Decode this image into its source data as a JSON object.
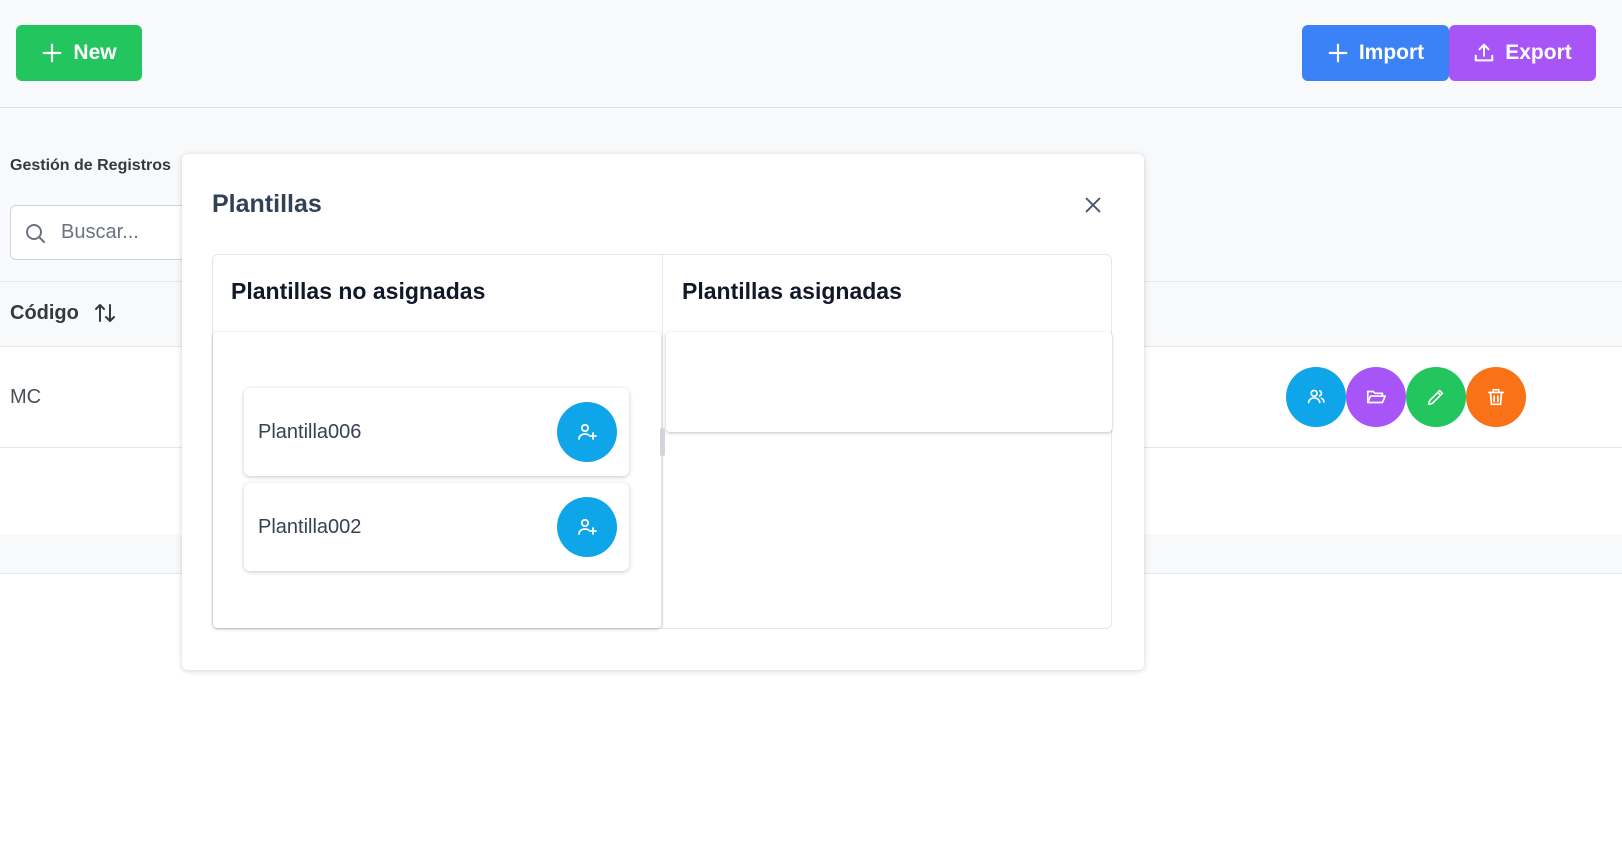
{
  "toolbar": {
    "new_label": "New",
    "import_label": "Import",
    "export_label": "Export"
  },
  "table": {
    "section_title": "Gestión de Registros",
    "search_placeholder": "Buscar...",
    "column_codigo": "Código",
    "rows": [
      {
        "codigo": "MC"
      }
    ],
    "row_actions": [
      "users-icon",
      "folder-open-icon",
      "pencil-icon",
      "trash-icon"
    ]
  },
  "modal": {
    "title": "Plantillas",
    "source_header": "Plantillas no asignadas",
    "target_header": "Plantillas asignadas",
    "source_items": [
      "Plantilla006",
      "Plantilla002"
    ],
    "target_items": []
  },
  "colors": {
    "new": "#22c55e",
    "import": "#3b82f6",
    "export": "#a855f7",
    "users": "#0ea5e9",
    "folder": "#a855f7",
    "edit": "#22c55e",
    "delete": "#f97316"
  }
}
